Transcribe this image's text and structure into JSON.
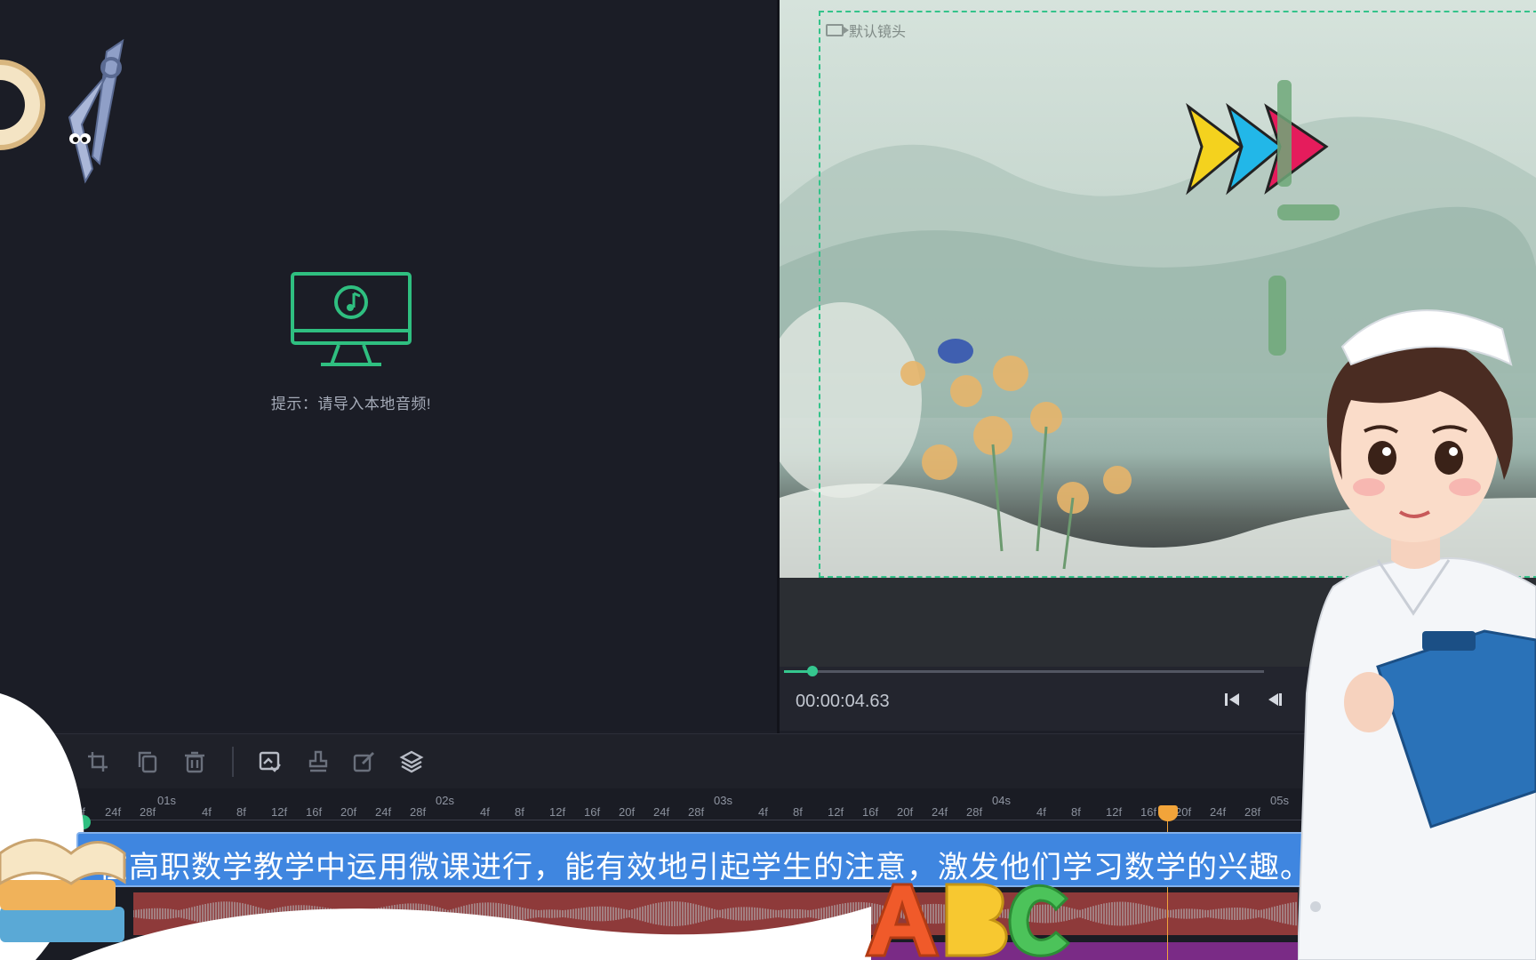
{
  "media_panel": {
    "empty_hint": "提示：请导入本地音频!",
    "icon": "music-monitor-icon"
  },
  "preview": {
    "camera_label": "默认镜头",
    "timecode": "00:00:04.63",
    "progress_fraction": 0.06,
    "accent_color": "#35c78f"
  },
  "toolbar": {
    "icons": [
      "crop-icon",
      "copy-icon",
      "delete-icon",
      "replace-image-icon",
      "stamp-icon",
      "edit-icon",
      "layers-icon"
    ]
  },
  "timeline": {
    "seconds": [
      "01s",
      "02s",
      "03s",
      "04s",
      "05s"
    ],
    "frames_first": [
      "4f",
      "24f",
      "28f"
    ],
    "frames_cycle": [
      "4f",
      "8f",
      "12f",
      "16f",
      "20f",
      "24f",
      "28f"
    ],
    "playhead_color": "#f2a43a"
  },
  "subtitle": {
    "text": "在高职数学教学中运用微课进行，能有效地引起学生的注意，激发他们学习数学的兴趣。"
  }
}
